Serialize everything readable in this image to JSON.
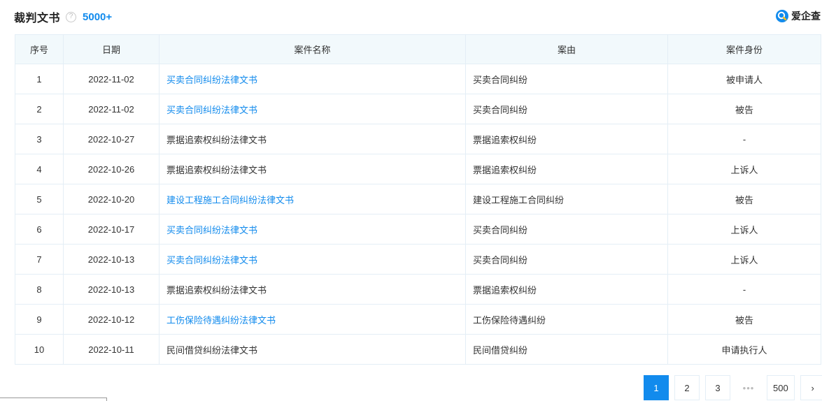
{
  "header": {
    "title": "裁判文书",
    "help_icon": "question-icon",
    "count": "5000+",
    "brand_name": "爱企查",
    "brand_icon": "search-logo-icon",
    "accent_color": "#128bed"
  },
  "table": {
    "columns": [
      "序号",
      "日期",
      "案件名称",
      "案由",
      "案件身份"
    ],
    "rows": [
      {
        "idx": "1",
        "date": "2022-11-02",
        "name": "买卖合同纠纷法律文书",
        "name_is_link": true,
        "cause": "买卖合同纠纷",
        "role": "被申请人"
      },
      {
        "idx": "2",
        "date": "2022-11-02",
        "name": "买卖合同纠纷法律文书",
        "name_is_link": true,
        "cause": "买卖合同纠纷",
        "role": "被告"
      },
      {
        "idx": "3",
        "date": "2022-10-27",
        "name": "票据追索权纠纷法律文书",
        "name_is_link": false,
        "cause": "票据追索权纠纷",
        "role": "-"
      },
      {
        "idx": "4",
        "date": "2022-10-26",
        "name": "票据追索权纠纷法律文书",
        "name_is_link": false,
        "cause": "票据追索权纠纷",
        "role": "上诉人"
      },
      {
        "idx": "5",
        "date": "2022-10-20",
        "name": "建设工程施工合同纠纷法律文书",
        "name_is_link": true,
        "cause": "建设工程施工合同纠纷",
        "role": "被告"
      },
      {
        "idx": "6",
        "date": "2022-10-17",
        "name": "买卖合同纠纷法律文书",
        "name_is_link": true,
        "cause": "买卖合同纠纷",
        "role": "上诉人"
      },
      {
        "idx": "7",
        "date": "2022-10-13",
        "name": "买卖合同纠纷法律文书",
        "name_is_link": true,
        "cause": "买卖合同纠纷",
        "role": "上诉人"
      },
      {
        "idx": "8",
        "date": "2022-10-13",
        "name": "票据追索权纠纷法律文书",
        "name_is_link": false,
        "cause": "票据追索权纠纷",
        "role": "-"
      },
      {
        "idx": "9",
        "date": "2022-10-12",
        "name": "工伤保险待遇纠纷法律文书",
        "name_is_link": true,
        "cause": "工伤保险待遇纠纷",
        "role": "被告"
      },
      {
        "idx": "10",
        "date": "2022-10-11",
        "name": "民间借贷纠纷法律文书",
        "name_is_link": false,
        "cause": "民间借贷纠纷",
        "role": "申请执行人"
      }
    ]
  },
  "pagination": {
    "pages": [
      "1",
      "2",
      "3"
    ],
    "current": "1",
    "ellipsis": "•••",
    "last": "500",
    "next_icon": "chevron-right-icon",
    "next_glyph": "›"
  }
}
